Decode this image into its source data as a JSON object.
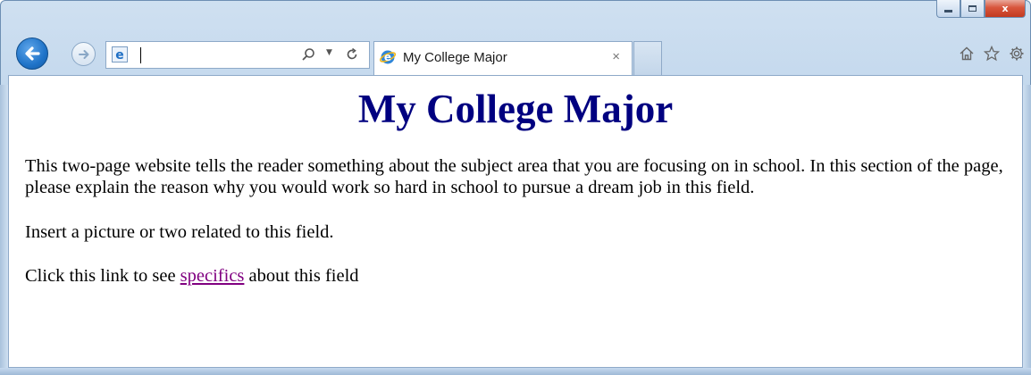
{
  "browser": {
    "address_value": "",
    "tab_title": "My College Major",
    "tab_close": "×",
    "caption": {
      "minimize": "",
      "maximize": "",
      "close": "x"
    },
    "icons": [
      "back-icon",
      "forward-icon",
      "ie-icon",
      "search-icon",
      "dropdown-icon",
      "refresh-icon",
      "close-icon",
      "home-icon",
      "favorites-star-icon",
      "settings-gear-icon"
    ]
  },
  "page": {
    "heading": "My College Major",
    "paragraph1": "This two-page website tells the reader something about the subject area that you are focusing on in school. In this section of the page, please explain the reason why you would work so hard in school to pursue a dream job in this field.",
    "paragraph2": "Insert a picture or two related to this field.",
    "paragraph3_before": "Click this link to see ",
    "paragraph3_link": "specifics",
    "paragraph3_after": " about this field"
  },
  "colors": {
    "heading": "#000080",
    "visited_link": "#800080",
    "frame": "#c6d9ee",
    "close_button": "#c23a1f"
  }
}
